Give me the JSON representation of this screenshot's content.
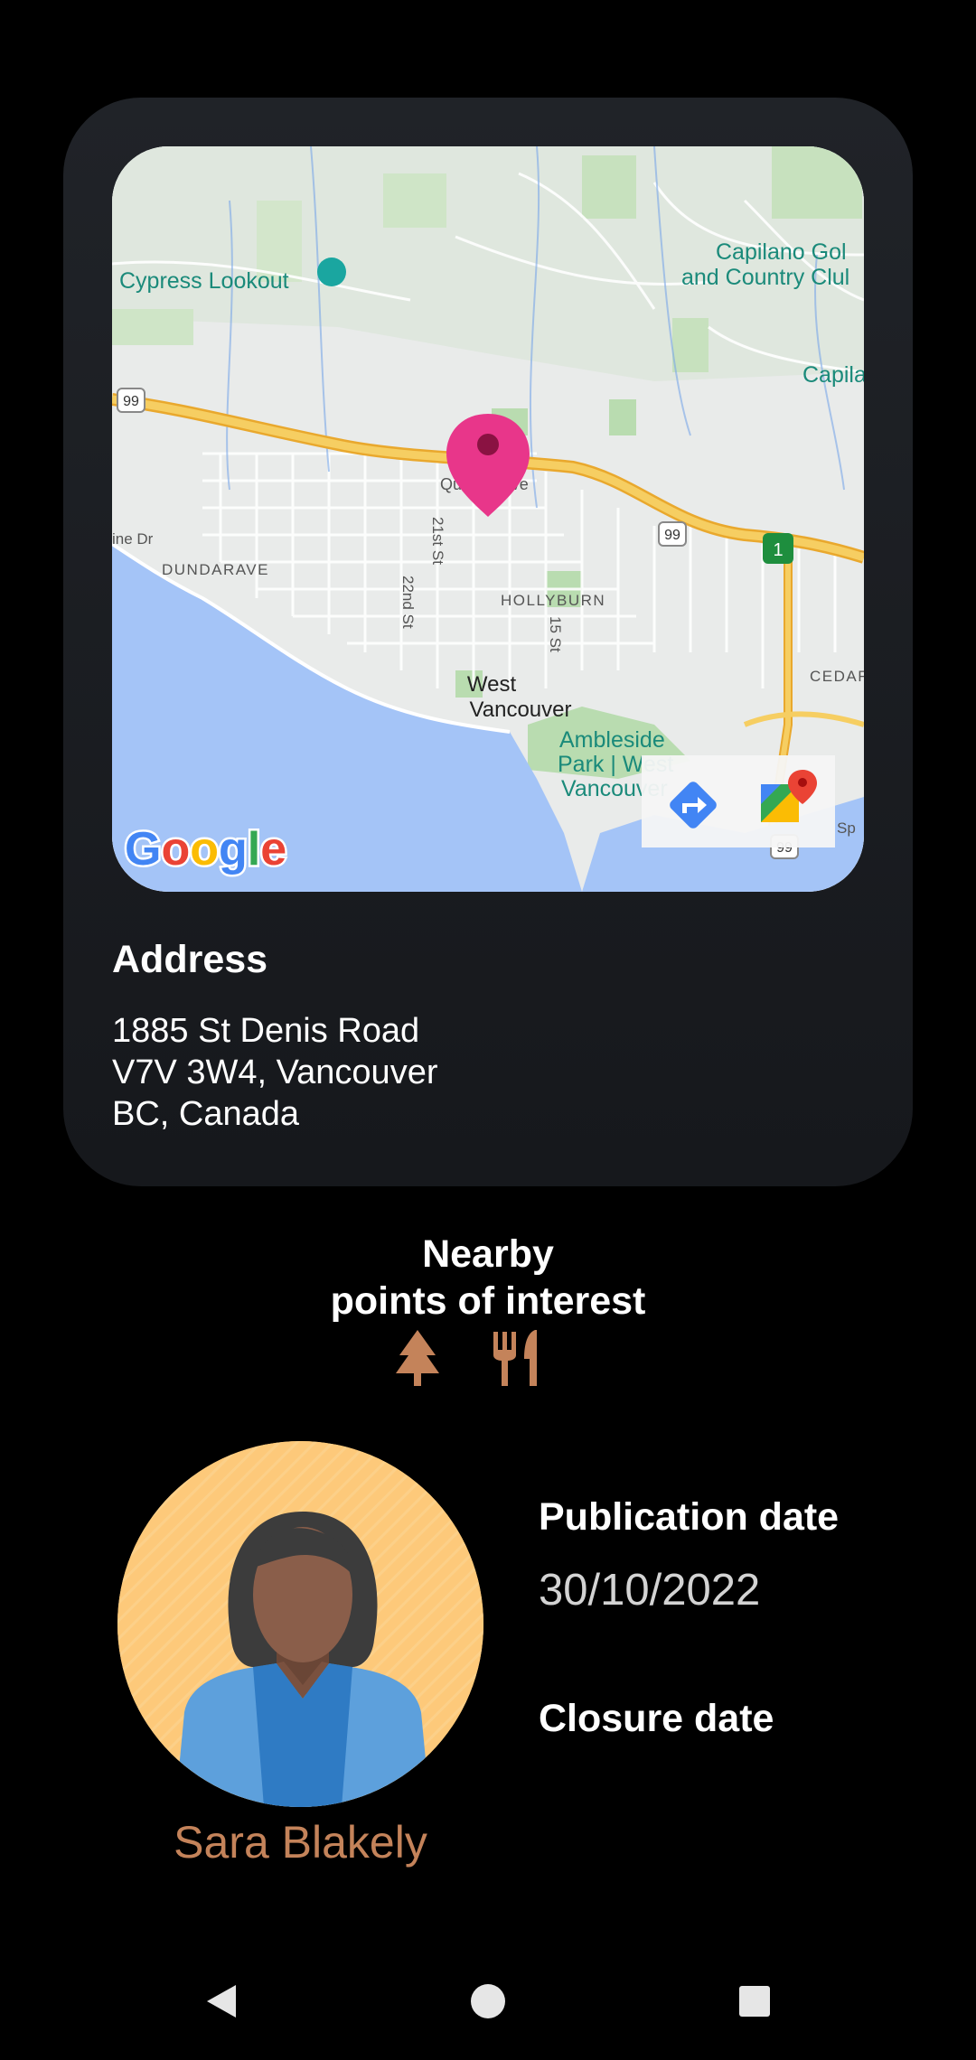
{
  "map": {
    "labels": {
      "cypress": "Cypress Lookout",
      "capilano1": "Capilano Gol",
      "capilano2": "and Country Clul",
      "capila": "Capila",
      "queens": "Queens Ave",
      "dundarave": "DUNDARAVE",
      "hollyburn": "HOLLYBURN",
      "west1": "West",
      "west2": "Vancouver",
      "amble1": "Ambleside",
      "amble2": "Park | West",
      "amble3": "Vancouver",
      "cedar": "CEDAR",
      "st21": "21st St",
      "st22": "22nd St",
      "st15": "15 St",
      "hwy": "99",
      "linedr": "ine Dr",
      "sp": "Sp",
      "google": "Google"
    },
    "colors": {
      "pin": "#e8368a",
      "water": "#a4c4f7",
      "land": "#e8ebe9",
      "park": "#b9dcb0",
      "highway": "#f4c34a"
    },
    "icons": {
      "pin": "location-pin-icon",
      "directions": "directions-icon",
      "maps_app": "google-maps-icon"
    }
  },
  "address": {
    "title": "Address",
    "line1": "1885 St Denis Road",
    "line2": "V7V 3W4, Vancouver",
    "line3": "BC, Canada"
  },
  "poi": {
    "title_line1": "Nearby",
    "title_line2": "points of interest",
    "icons": [
      "tree-icon",
      "restaurant-icon"
    ],
    "icon_color": "#c4835a"
  },
  "user": {
    "name": "Sara Blakely",
    "avatar_bg": "#fdc97a"
  },
  "dates": {
    "publication_label": "Publication date",
    "publication_value": "30/10/2022",
    "closure_label": "Closure date"
  },
  "navbar": {
    "icons": [
      "back-icon",
      "home-icon",
      "recents-icon"
    ]
  }
}
